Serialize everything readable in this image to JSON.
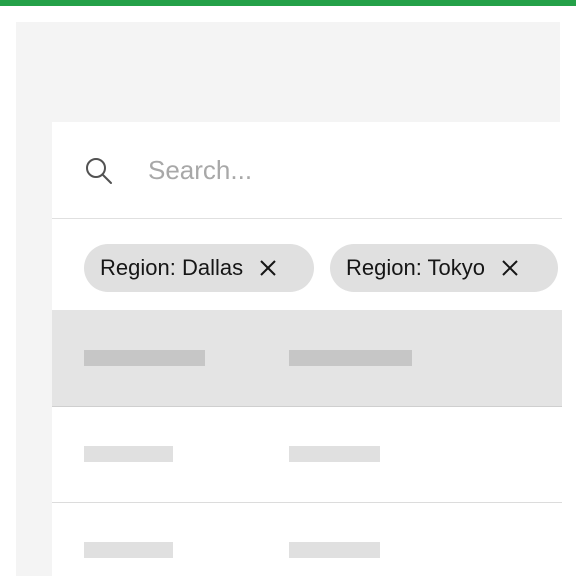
{
  "search": {
    "placeholder": "Search...",
    "value": ""
  },
  "filters": [
    {
      "label": "Region: Dallas",
      "remove_icon": "close-icon"
    },
    {
      "label": "Region: Tokyo",
      "remove_icon": "close-icon"
    }
  ],
  "icons": {
    "search": "search-icon",
    "remove": "close-icon"
  },
  "colors": {
    "accent_bar": "#24a148",
    "panel_bg": "#f4f4f4",
    "chip_bg": "#e0e0e0",
    "header_bg": "#e4e4e4",
    "skeleton": "#c6c6c6"
  },
  "table": {
    "state": "loading-skeleton",
    "columns": 2,
    "visible_rows": 2
  }
}
